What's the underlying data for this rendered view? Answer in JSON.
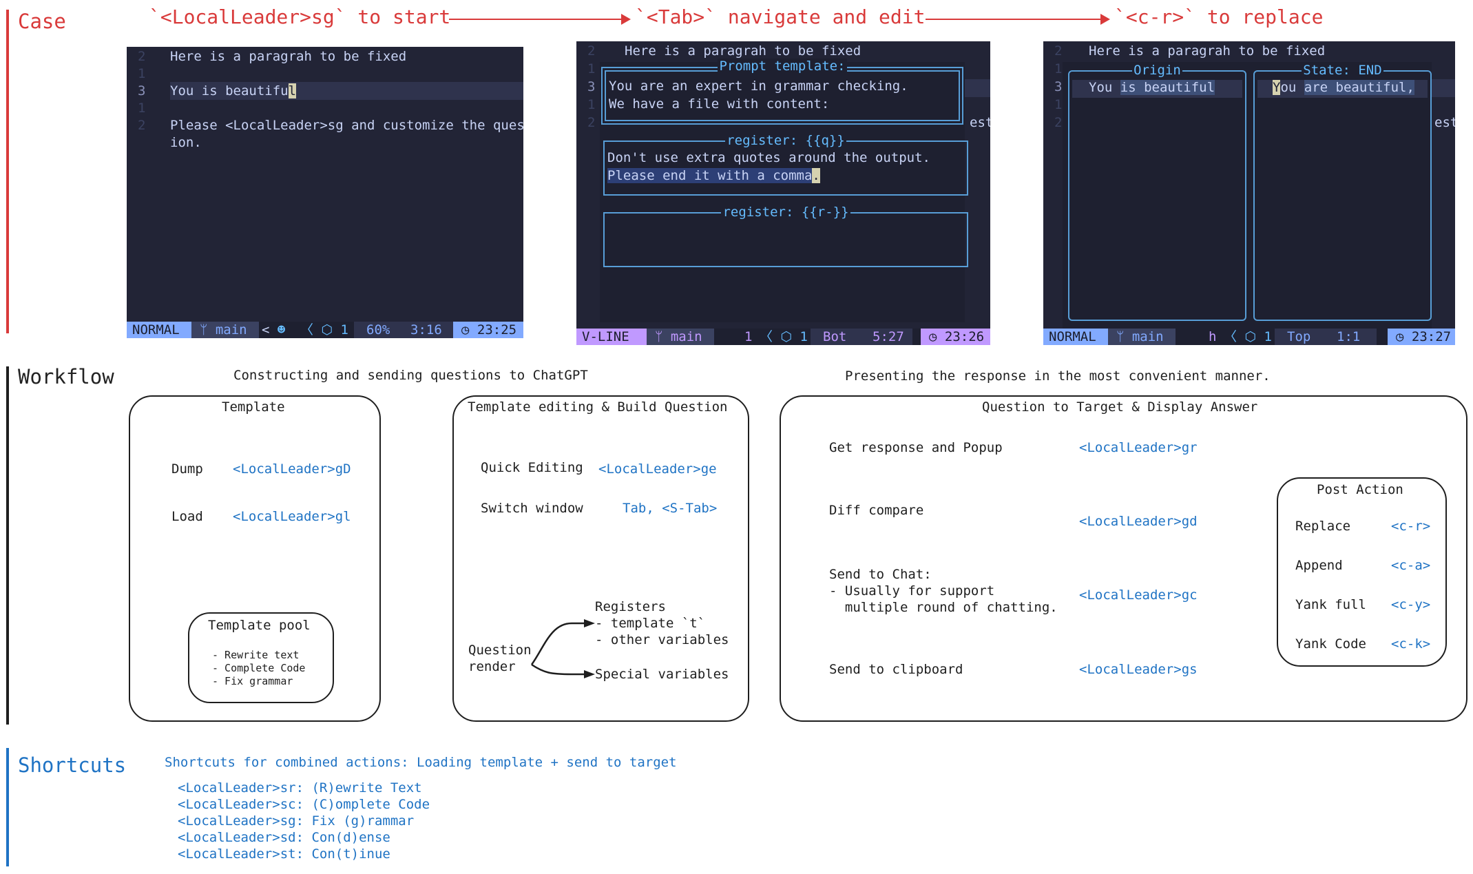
{
  "sections": {
    "case": {
      "title": "Case",
      "color": "#d93a3a"
    },
    "workflow": {
      "title": "Workflow",
      "color": "#1e1e1e"
    },
    "shortcuts": {
      "title": "Shortcuts",
      "color": "#1f73c4"
    }
  },
  "steps": [
    "`<LocalLeader>sg` to start",
    "`<Tab>` navigate and edit",
    "`<c-r>` to replace"
  ],
  "panel1": {
    "line_numbers": [
      "2",
      "1",
      "3",
      "1",
      "2"
    ],
    "lines": [
      "Here is a paragrah to be fixed",
      "",
      "You is beautifu",
      "",
      "Please <LocalLeader>sg and customize the quest",
      "ion."
    ],
    "cursor_char": "l",
    "status": {
      "mode": "NORMAL",
      "branch": "main",
      "extra": "< ",
      "bot_icon": "copilot-icon",
      "diag": "1",
      "percent": "60%",
      "position": "3:16",
      "time": "23:25"
    }
  },
  "panel2": {
    "line_numbers": [
      "2",
      "1",
      "3",
      "1",
      "2"
    ],
    "first_line": "Here is a paragrah to be fixed",
    "right_overflow": "est",
    "prompt_box": {
      "title": "Prompt template:",
      "lines": [
        "You are an expert in grammar checking.",
        "We have a file with content:"
      ]
    },
    "register_q": {
      "title": "register: {{q}}",
      "line1": "Don't use extra quotes around the output.",
      "line2_selected": "Please end it with a comma",
      "cursor_char": "."
    },
    "register_r": {
      "title": "register: {{r-}}"
    },
    "status": {
      "mode": "V-LINE",
      "branch": "main",
      "sel_count": "1",
      "diag": "1",
      "percent": "Bot",
      "position": "5:27",
      "time": "23:26"
    }
  },
  "panel3": {
    "line_numbers": [
      "2",
      "1",
      "3",
      "1",
      "2"
    ],
    "first_line": "Here is a paragrah to be fixed",
    "right_overflow": "est",
    "origin": {
      "title": "Origin",
      "plain": "You ",
      "diff": "is beautiful"
    },
    "state": {
      "title": "State: END",
      "cursor_char": "Y",
      "plain": "ou ",
      "diff": "are beautiful,"
    },
    "status": {
      "mode": "NORMAL",
      "branch": "main",
      "key": "h",
      "diag": "1",
      "percent": "Top",
      "position": "1:1",
      "time": "23:27"
    }
  },
  "workflow": {
    "left_caption": "Constructing and sending questions to ChatGPT",
    "right_caption": "Presenting the response in the most convenient manner.",
    "template_box": {
      "title": "Template",
      "rows": [
        {
          "label": "Dump",
          "key": "<LocalLeader>gD"
        },
        {
          "label": "Load",
          "key": "<LocalLeader>gl"
        }
      ],
      "pool": {
        "title": "Template pool",
        "items": [
          "- Rewrite text",
          "- Complete Code",
          "- Fix grammar"
        ]
      }
    },
    "edit_box": {
      "title": "Template editing & Build Question",
      "rows": [
        {
          "label": "Quick Editing",
          "key": "<LocalLeader>ge"
        },
        {
          "label": "Switch window",
          "key": "Tab, <S-Tab>"
        }
      ],
      "render": {
        "source_line1": "Question",
        "source_line2": "render",
        "registers_title": "Registers",
        "registers_items": [
          "- template `t`",
          "- other variables"
        ],
        "special": "Special variables"
      }
    },
    "target_box": {
      "title": "Question to Target & Display Answer",
      "rows": [
        {
          "label": "Get response and Popup",
          "key": "<LocalLeader>gr"
        },
        {
          "label": "Diff compare",
          "key": "<LocalLeader>gd"
        },
        {
          "label": "Send to Chat:",
          "label2": "- Usually for support",
          "label3": "  multiple round of chatting.",
          "key": "<LocalLeader>gc"
        },
        {
          "label": "Send to clipboard",
          "key": "<LocalLeader>gs"
        }
      ],
      "post_action": {
        "title": "Post Action",
        "rows": [
          {
            "label": "Replace",
            "key": "<c-r>"
          },
          {
            "label": "Append",
            "key": "<c-a>"
          },
          {
            "label": "Yank full",
            "key": "<c-y>"
          },
          {
            "label": "Yank Code",
            "key": "<c-k>"
          }
        ]
      }
    }
  },
  "shortcuts": {
    "caption": "Shortcuts for combined actions: Loading template + send to target",
    "items": [
      "<LocalLeader>sr: (R)ewrite Text",
      "<LocalLeader>sc: (C)omplete Code",
      "<LocalLeader>sg: Fix (g)rammar",
      "<LocalLeader>sd: Con(d)ense",
      "<LocalLeader>st: Con(t)inue"
    ]
  },
  "colors": {
    "normal_mode": "#82aaff",
    "vline_mode": "#c099ff",
    "accent_blue": "#1f73c4",
    "accent_red": "#d93a3a",
    "term_bg": "#222436"
  }
}
